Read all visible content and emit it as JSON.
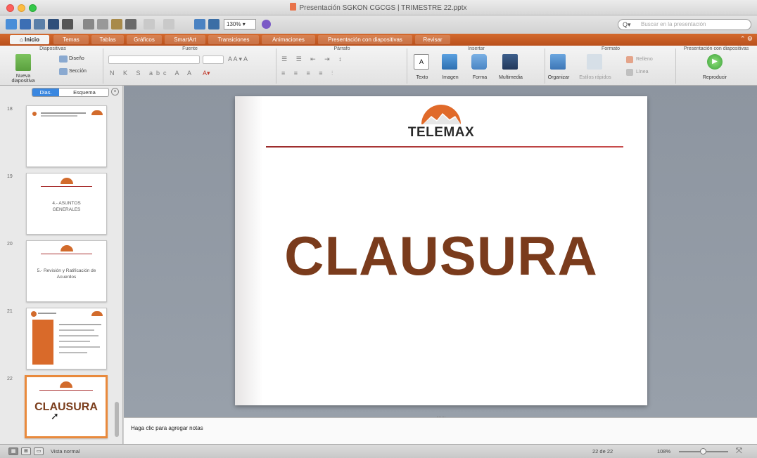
{
  "window": {
    "title": "Presentación SGKON CGCGS | TRIMESTRE 22.pptx"
  },
  "quick_access": {
    "zoom": "130%",
    "search_placeholder": "Buscar en la presentación"
  },
  "ribbon_tabs": [
    "Inicio",
    "Temas",
    "Tablas",
    "Gráficos",
    "SmartArt",
    "Transiciones",
    "Animaciones",
    "Presentación con diapositivas",
    "Revisar"
  ],
  "ribbon": {
    "groups": {
      "diapositivas": "Diapositivas",
      "fuente": "Fuente",
      "parrafo": "Párrafo",
      "insertar": "Insertar",
      "formato": "Formato",
      "presentacion": "Presentación con diapositivas"
    },
    "buttons": {
      "nueva_diapositiva": "Nueva diapositiva",
      "diseno": "Diseño",
      "seccion": "Sección",
      "texto": "Texto",
      "imagen": "Imagen",
      "forma": "Forma",
      "multimedia": "Multimedia",
      "organizar": "Organizar",
      "estilos_rapidos": "Estilos rápidos",
      "relleno": "Relleno",
      "linea": "Línea",
      "reproducir": "Reproducir"
    }
  },
  "sidebar": {
    "tabs": [
      "Dias.",
      "Esquema"
    ],
    "slides": [
      {
        "number": "18",
        "text": ""
      },
      {
        "number": "19",
        "text": "4.- ASUNTOS GENERALES"
      },
      {
        "number": "20",
        "text": "5.- Revisión y Ratificación de Acuerdos"
      },
      {
        "number": "21",
        "text": ""
      },
      {
        "number": "22",
        "text": "CLAUSURA"
      }
    ]
  },
  "slide": {
    "logo_text": "TELEMAX",
    "title": "CLAUSURA"
  },
  "notes": {
    "placeholder": "Haga clic para agregar notas"
  },
  "status": {
    "view": "Vista normal",
    "slide_position": "22 de 22",
    "zoom": "108%"
  },
  "colors": {
    "ribbon_orange": "#c85d24",
    "title_brown": "#7a3b1c",
    "logo_orange": "#e06a2a",
    "rule_red": "#a83030"
  }
}
